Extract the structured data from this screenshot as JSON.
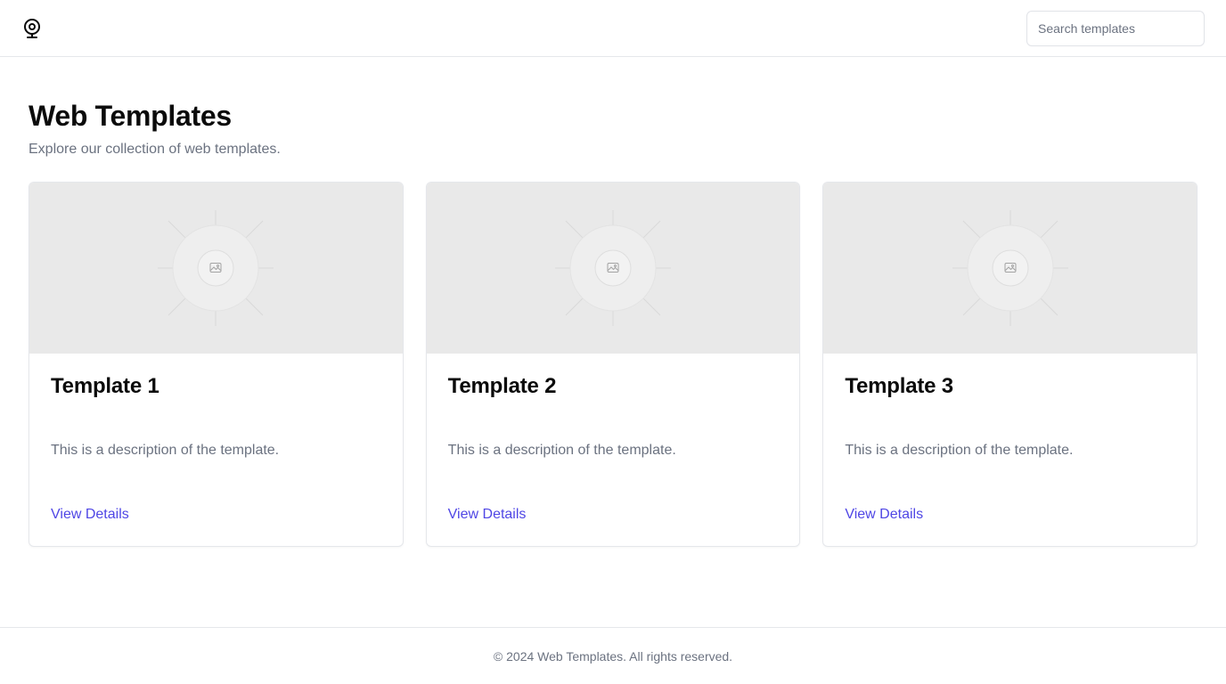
{
  "header": {
    "logo_icon": "webcam-icon",
    "search_placeholder": "Search templates",
    "search_value": ""
  },
  "main": {
    "title": "Web Templates",
    "subtitle": "Explore our collection of web templates."
  },
  "templates": [
    {
      "title": "Template 1",
      "description": "This is a description of the template.",
      "link_label": "View Details",
      "image_icon": "image-placeholder-icon"
    },
    {
      "title": "Template 2",
      "description": "This is a description of the template.",
      "link_label": "View Details",
      "image_icon": "image-placeholder-icon"
    },
    {
      "title": "Template 3",
      "description": "This is a description of the template.",
      "link_label": "View Details",
      "image_icon": "image-placeholder-icon"
    }
  ],
  "footer": {
    "text": "© 2024 Web Templates. All rights reserved."
  },
  "colors": {
    "accent": "#4f46e5",
    "muted_text": "#6b7280",
    "border": "#e5e7eb",
    "placeholder_bg": "#e9e9e9"
  }
}
